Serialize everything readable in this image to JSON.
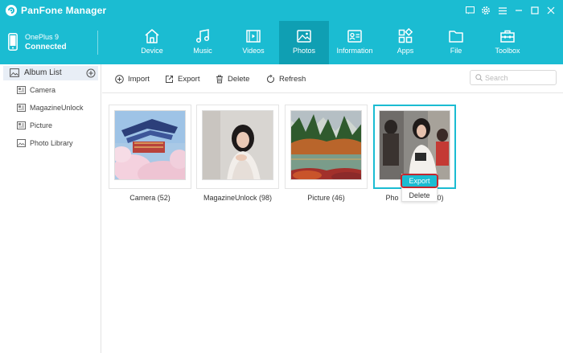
{
  "app": {
    "title": "PanFone Manager"
  },
  "device": {
    "name": "OnePlus 9",
    "status": "Connected"
  },
  "nav": {
    "tabs": [
      {
        "label": "Device",
        "icon": "home-icon"
      },
      {
        "label": "Music",
        "icon": "music-icon"
      },
      {
        "label": "Videos",
        "icon": "video-icon"
      },
      {
        "label": "Photos",
        "icon": "photo-icon",
        "active": true
      },
      {
        "label": "Information",
        "icon": "contact-card-icon"
      },
      {
        "label": "Apps",
        "icon": "apps-icon"
      },
      {
        "label": "File",
        "icon": "folder-icon"
      },
      {
        "label": "Toolbox",
        "icon": "toolbox-icon"
      }
    ]
  },
  "sidebar": {
    "header": "Album List",
    "items": [
      {
        "label": "Camera"
      },
      {
        "label": "MagazineUnlock"
      },
      {
        "label": "Picture"
      },
      {
        "label": "Photo Library"
      }
    ]
  },
  "toolbar": {
    "import": "Import",
    "export": "Export",
    "delete": "Delete",
    "refresh": "Refresh",
    "search_placeholder": "Search"
  },
  "albums": [
    {
      "label": "Camera (52)"
    },
    {
      "label": "MagazineUnlock (98)"
    },
    {
      "label": "Picture (46)"
    },
    {
      "label": "Pho",
      "label_tail": "0)",
      "selected": true
    }
  ],
  "context_menu": {
    "export": "Export",
    "delete": "Delete"
  },
  "colors": {
    "accent": "#1bbcd2",
    "accent_dark": "#0f9fb3",
    "highlight": "#c4262e"
  }
}
